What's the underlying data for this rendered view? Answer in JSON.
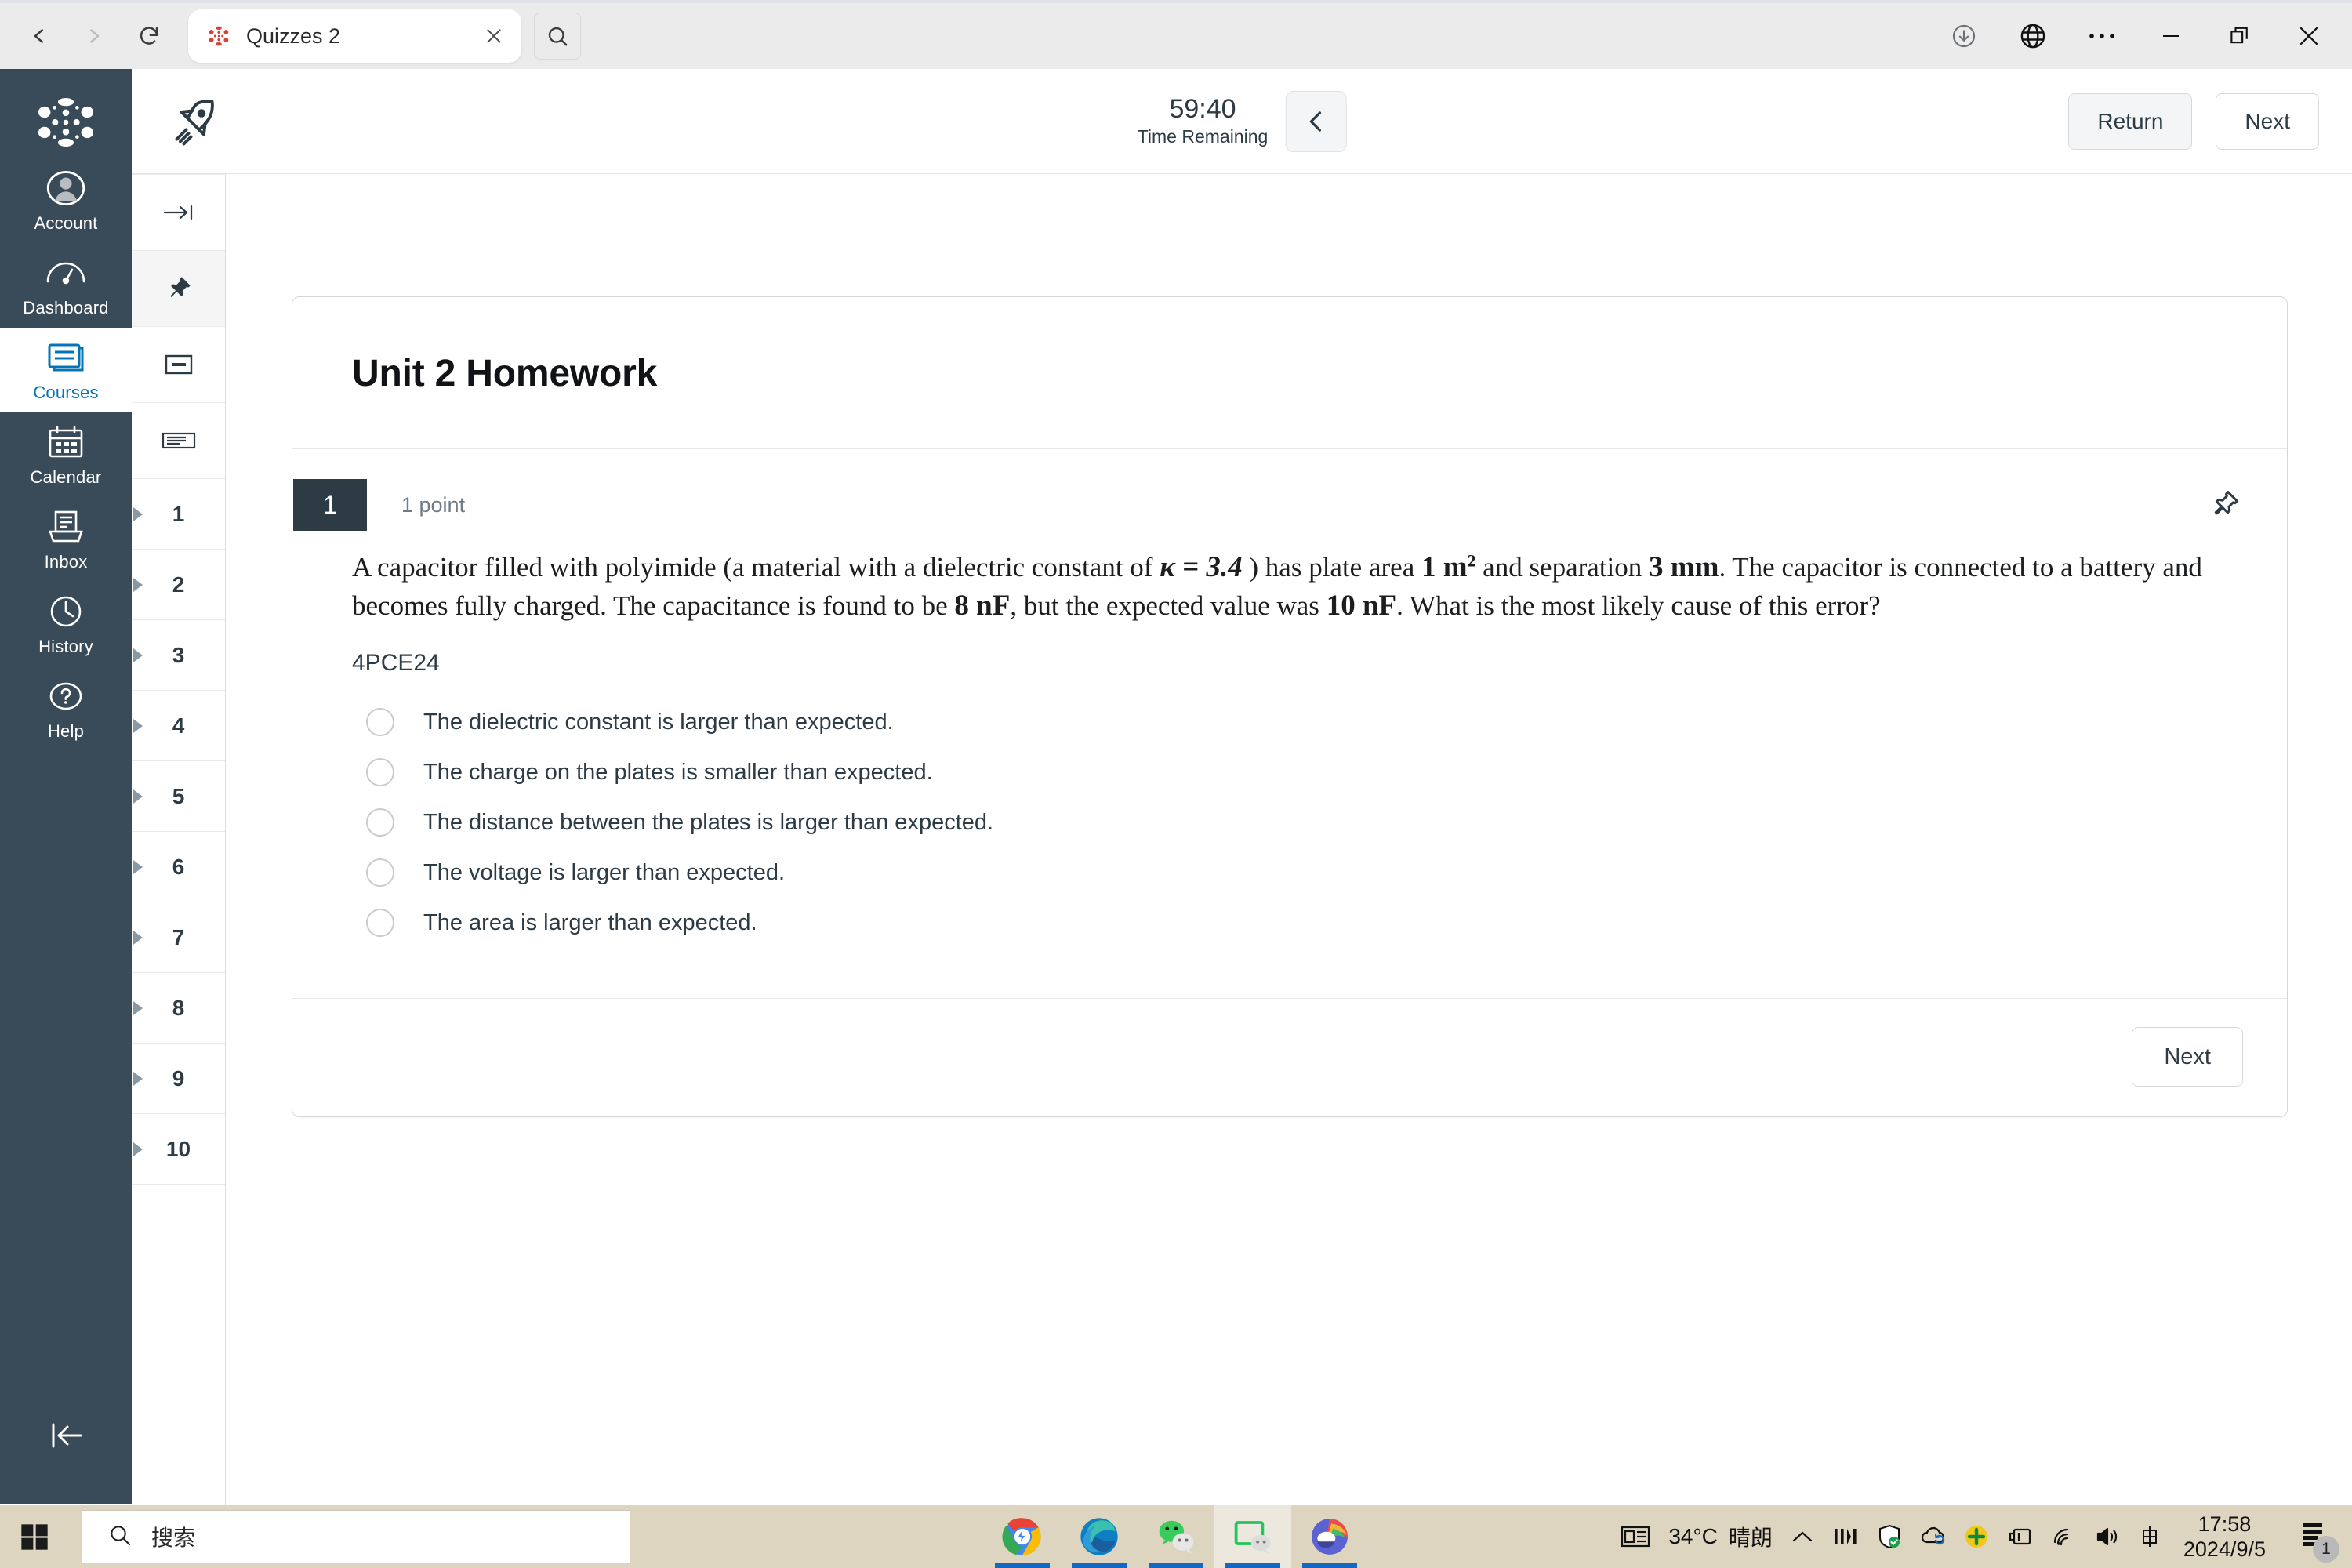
{
  "browser": {
    "back_icon": "back-arrow-icon",
    "forward_icon": "forward-arrow-icon",
    "reload_icon": "reload-icon",
    "tab": {
      "title": "Quizzes 2",
      "favicon": "canvas-logo-icon",
      "close_icon": "close-icon"
    },
    "tab_search_icon": "search-icon",
    "window_controls": {
      "downloads_icon": "download-icon",
      "translate_icon": "globe-icon",
      "more_icon": "ellipsis-icon",
      "minimize_icon": "minimize-icon",
      "maximize_icon": "restore-icon",
      "close_icon": "close-icon"
    }
  },
  "global_nav": {
    "logo": "canvas-logo-icon",
    "items": [
      {
        "label": "Account",
        "icon": "user-avatar-icon",
        "active": false
      },
      {
        "label": "Dashboard",
        "icon": "dashboard-gauge-icon",
        "active": false
      },
      {
        "label": "Courses",
        "icon": "courses-book-icon",
        "active": true
      },
      {
        "label": "Calendar",
        "icon": "calendar-icon",
        "active": false
      },
      {
        "label": "Inbox",
        "icon": "inbox-tray-icon",
        "active": false
      },
      {
        "label": "History",
        "icon": "clock-icon",
        "active": false
      },
      {
        "label": "Help",
        "icon": "question-circle-icon",
        "active": false
      }
    ],
    "collapse_icon": "collapse-left-icon"
  },
  "question_rail": {
    "tools": [
      {
        "icon": "expand-right-icon",
        "name": "expand-panel-toggle",
        "selected": false
      },
      {
        "icon": "pin-icon",
        "name": "pinned-questions-filter",
        "selected": true
      },
      {
        "icon": "question-block-icon",
        "name": "question-view-toggle",
        "selected": false
      },
      {
        "icon": "list-view-icon",
        "name": "list-view-toggle",
        "selected": false
      }
    ],
    "questions": [
      "1",
      "2",
      "3",
      "4",
      "5",
      "6",
      "7",
      "8",
      "9",
      "10"
    ]
  },
  "quiz_header": {
    "rocket_icon": "rocket-icon",
    "timer_value": "59:40",
    "timer_label": "Time Remaining",
    "collapse_icon": "chevron-left-icon",
    "return_label": "Return",
    "next_label": "Next"
  },
  "quiz": {
    "title": "Unit 2 Homework",
    "question": {
      "number": "1",
      "points": "1 point",
      "pin_icon": "pin-icon",
      "text_part1": "A capacitor filled with polyimide (a material with a dielectric constant of ",
      "kappa": "κ = 3.4",
      "text_part2": " ) has plate area ",
      "area": "1 m",
      "area_exp": "2",
      "text_part3": " and separation ",
      "separation": "3 mm",
      "text_part4": ". The capacitor is connected to a battery and becomes fully charged. The capacitance is found to be ",
      "measured": "8 nF",
      "text_part5": ", but the expected value was ",
      "expected": "10 nF",
      "text_part6": ". What is the most likely cause of this error?",
      "code": "4PCE24",
      "answers": [
        "The dielectric constant is larger than expected.",
        "The charge on the plates is smaller than expected.",
        "The distance between the plates is larger than expected.",
        "The voltage is larger than expected.",
        "The area is larger than expected."
      ],
      "selected_answer": null
    },
    "footer_next_label": "Next"
  },
  "taskbar": {
    "start_icon": "windows-start-icon",
    "search_placeholder": "搜索",
    "search_icon": "search-icon",
    "apps": [
      {
        "name": "chrome-taskbar-icon",
        "active": false
      },
      {
        "name": "edge-taskbar-icon",
        "active": false
      },
      {
        "name": "wechat-taskbar-icon",
        "active": false
      },
      {
        "name": "wechat-devtools-taskbar-icon",
        "active": true
      },
      {
        "name": "weather-app-taskbar-icon",
        "active": false
      }
    ],
    "tray": {
      "news_icon": "news-weather-icon",
      "temperature": "34°C",
      "condition": "晴朗",
      "chevron_icon": "chevron-up-icon",
      "icons": [
        "network-meter-icon",
        "security-shield-icon",
        "onedrive-sync-icon",
        "update-icon",
        "power-plug-icon",
        "wifi-icon",
        "volume-icon",
        "ime-chinese-icon"
      ],
      "time": "17:58",
      "date": "2024/9/5",
      "notification_icon": "notification-icon",
      "notification_count": "1"
    }
  }
}
